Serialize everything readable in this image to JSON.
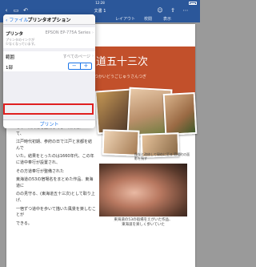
{
  "status_bar": {
    "time": "12:28"
  },
  "title_bar": {
    "doc_title": "文書 1"
  },
  "ribbon": {
    "tabs": [
      "レイアウト",
      "校閲",
      "表示"
    ]
  },
  "print_options": {
    "back_label": "ファイル",
    "title": "プリンタオプション",
    "printer_label": "プリンタ",
    "printer_name": "EPSON EP-775A Series",
    "printer_note_line1": "プリンタのインクが",
    "printer_note_line2": "少なくなっています。",
    "range_label": "範囲",
    "range_value": "すべてのページ",
    "copies_label": "1部",
    "stepper_minus": "−",
    "stepper_plus": "+",
    "print_button": "プリント"
  },
  "document": {
    "banner_title": "道五十三次",
    "banner_subtitle": "つかいどうごじゅうさんつぎ",
    "caption1": "保存と改修して現在に至る 宿場町の面影を残す",
    "body_paragraphs": [
      "もった東海道を整備してきた東海道について、",
      "江戸時代初期、参府の日で江戸と京都を結んで",
      "いた。結果をとったのは1660年代、この年に道中奉行が設置され、",
      "その方道奉行が整備された",
      "東海道の53の宿場名をまとめた作品、東海道に",
      "のの見守る、(東海道五十三次)として取り上げ、",
      "一宿ずつ道中を歩いて描いた風景を楽しむことが",
      "できる。"
    ],
    "caption2_line1": "東海道の53の宿場をえがいた作品、",
    "caption2_line2": "東海道を楽しく歩いていた"
  }
}
